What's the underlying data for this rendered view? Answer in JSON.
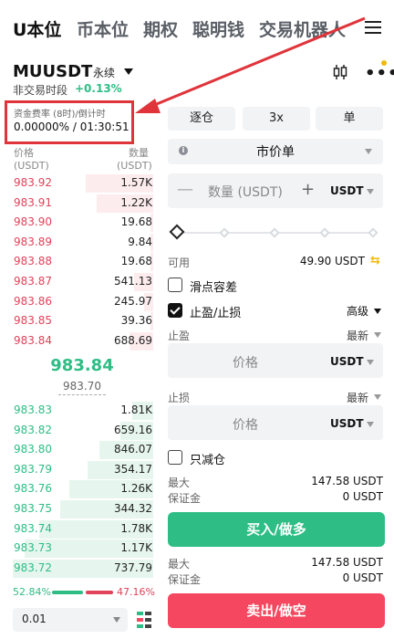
{
  "top_tabs": [
    {
      "label": "U本位",
      "active": true
    },
    {
      "label": "币本位",
      "active": false
    },
    {
      "label": "期权",
      "active": false
    },
    {
      "label": "聪明钱",
      "active": false
    },
    {
      "label": "交易机器人",
      "active": false
    }
  ],
  "header": {
    "symbol": "MUUSDT",
    "contract_type": "永续",
    "session": "非交易时段",
    "change": "+0.13%"
  },
  "funding": {
    "label": "资金费率 (8时)/倒计时",
    "value": "0.00000% / 01:30:51"
  },
  "order_book": {
    "price_header": "价格",
    "price_unit": "(USDT)",
    "qty_header": "数量",
    "qty_unit": "(USDT)",
    "asks": [
      {
        "price": "983.92",
        "qty": "1.57K",
        "depth": 0.45
      },
      {
        "price": "983.91",
        "qty": "1.22K",
        "depth": 0.38
      },
      {
        "price": "983.90",
        "qty": "19.68",
        "depth": 0.02
      },
      {
        "price": "983.89",
        "qty": "9.84",
        "depth": 0.02
      },
      {
        "price": "983.88",
        "qty": "19.68",
        "depth": 0.02
      },
      {
        "price": "983.87",
        "qty": "541.13",
        "depth": 0.13
      },
      {
        "price": "983.86",
        "qty": "245.97",
        "depth": 0.06
      },
      {
        "price": "983.85",
        "qty": "39.36",
        "depth": 0.02
      },
      {
        "price": "983.84",
        "qty": "688.69",
        "depth": 0.16
      }
    ],
    "mid_price": "983.84",
    "mark_price": "983.70",
    "bids": [
      {
        "price": "983.83",
        "qty": "1.81K",
        "depth": 0.14
      },
      {
        "price": "983.82",
        "qty": "659.16",
        "depth": 0.22
      },
      {
        "price": "983.80",
        "qty": "846.07",
        "depth": 0.36
      },
      {
        "price": "983.79",
        "qty": "354.17",
        "depth": 0.44
      },
      {
        "price": "983.76",
        "qty": "1.26K",
        "depth": 0.56
      },
      {
        "price": "983.75",
        "qty": "344.32",
        "depth": 0.62
      },
      {
        "price": "983.74",
        "qty": "1.78K",
        "depth": 0.76
      },
      {
        "price": "983.73",
        "qty": "1.17K",
        "depth": 0.86
      },
      {
        "price": "983.72",
        "qty": "737.79",
        "depth": 0.94
      }
    ],
    "buy_ratio": "52.84%",
    "sell_ratio": "47.16%",
    "precision": "0.01"
  },
  "trade": {
    "margin_mode": "逐仓",
    "leverage": "3x",
    "position_mode": "单",
    "order_type": "市价单",
    "quantity_placeholder": "数量 (USDT)",
    "quantity_unit": "USDT",
    "available_label": "可用",
    "available_value": "49.90 USDT",
    "slippage_label": "滑点容差",
    "slippage_checked": false,
    "tpsl_label": "止盈/止损",
    "tpsl_checked": true,
    "advanced_label": "高级",
    "tp_label": "止盈",
    "tp_trigger": "最新",
    "tp_price_placeholder": "价格",
    "tp_unit": "USDT",
    "sl_label": "止损",
    "sl_trigger": "最新",
    "sl_price_placeholder": "价格",
    "sl_unit": "USDT",
    "reduce_only_label": "只减仓",
    "reduce_only_checked": false,
    "buy_max_label": "最大",
    "buy_max_value": "147.58 USDT",
    "buy_margin_label": "保证金",
    "buy_margin_value": "0 USDT",
    "buy_button": "买入/做多",
    "sell_max_label": "最大",
    "sell_max_value": "147.58 USDT",
    "sell_margin_label": "保证金",
    "sell_margin_value": "0 USDT",
    "sell_button": "卖出/做空"
  },
  "colors": {
    "buy": "#2ebd85",
    "sell": "#f5475f",
    "annotation": "#e0333a"
  },
  "icons": [
    "menu-icon",
    "chevron-down-icon",
    "candlestick-chart-icon",
    "more-icon",
    "info-icon",
    "swap-icon",
    "layout-icon"
  ]
}
